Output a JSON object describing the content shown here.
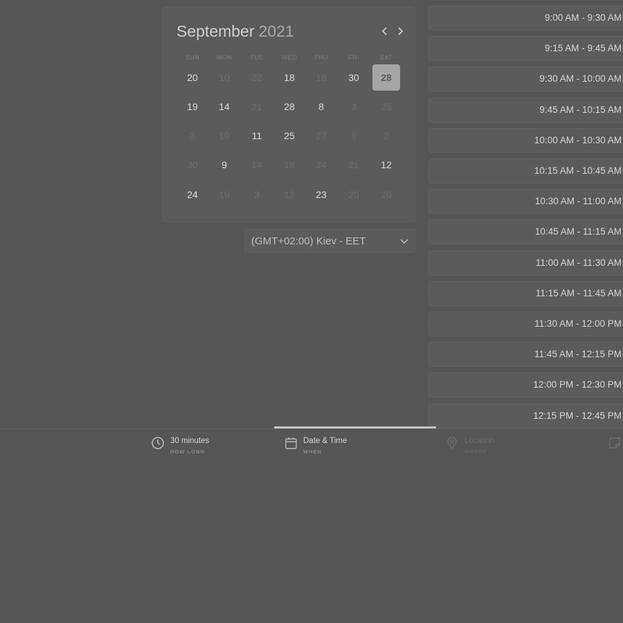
{
  "calendar": {
    "month": "September",
    "year": "2021",
    "weekdays": [
      "SUN",
      "MON",
      "TUE",
      "WED",
      "THU",
      "FRI",
      "SAT"
    ],
    "weeks": [
      [
        {
          "d": "20",
          "on": true
        },
        {
          "d": "10",
          "on": false
        },
        {
          "d": "22",
          "on": false
        },
        {
          "d": "18",
          "on": true
        },
        {
          "d": "16",
          "on": false
        },
        {
          "d": "30",
          "on": true
        },
        {
          "d": "28",
          "on": true,
          "selected": true
        }
      ],
      [
        {
          "d": "19",
          "on": true
        },
        {
          "d": "14",
          "on": true
        },
        {
          "d": "21",
          "on": false
        },
        {
          "d": "28",
          "on": true
        },
        {
          "d": "8",
          "on": true
        },
        {
          "d": "3",
          "on": false
        },
        {
          "d": "25",
          "on": false
        }
      ],
      [
        {
          "d": "3",
          "on": false
        },
        {
          "d": "10",
          "on": false
        },
        {
          "d": "11",
          "on": true
        },
        {
          "d": "25",
          "on": true
        },
        {
          "d": "27",
          "on": false
        },
        {
          "d": "9",
          "on": false
        },
        {
          "d": "2",
          "on": false
        }
      ],
      [
        {
          "d": "30",
          "on": false
        },
        {
          "d": "9",
          "on": true
        },
        {
          "d": "14",
          "on": false
        },
        {
          "d": "18",
          "on": false
        },
        {
          "d": "24",
          "on": false
        },
        {
          "d": "21",
          "on": false
        },
        {
          "d": "12",
          "on": true
        }
      ],
      [
        {
          "d": "24",
          "on": true
        },
        {
          "d": "19",
          "on": false
        },
        {
          "d": "3",
          "on": false
        },
        {
          "d": "12",
          "on": false
        },
        {
          "d": "23",
          "on": true
        },
        {
          "d": "20",
          "on": false
        },
        {
          "d": "20",
          "on": false
        }
      ]
    ]
  },
  "timezone": {
    "label": "(GMT+02:00) Kiev - EET"
  },
  "slots": [
    "9:00 AM - 9:30 AM",
    "9:15 AM - 9:45 AM",
    "9:30 AM - 10:00 AM",
    "9:45 AM - 10:15 AM",
    "10:00 AM - 10:30 AM",
    "10:15 AM - 10:45 AM",
    "10:30 AM - 11:00 AM",
    "10:45 AM - 11:15 AM",
    "11:00 AM - 11:30 AM",
    "11:15 AM - 11:45 AM",
    "11:30 AM - 12:00 PM",
    "11:45 AM - 12:15 PM",
    "12:00 PM - 12:30 PM",
    "12:15 PM - 12:45 PM"
  ],
  "steps": [
    {
      "title": "30 minutes",
      "sub": "HOW LONG",
      "icon": "clock-icon",
      "state": "active"
    },
    {
      "title": "Date & Time",
      "sub": "WHEN",
      "icon": "calendar-icon",
      "state": "active"
    },
    {
      "title": "Location",
      "sub": "WHERE",
      "icon": "location-pin-icon",
      "state": "dim"
    },
    {
      "title": "",
      "sub": "",
      "icon": "note-icon",
      "state": "dim"
    }
  ]
}
